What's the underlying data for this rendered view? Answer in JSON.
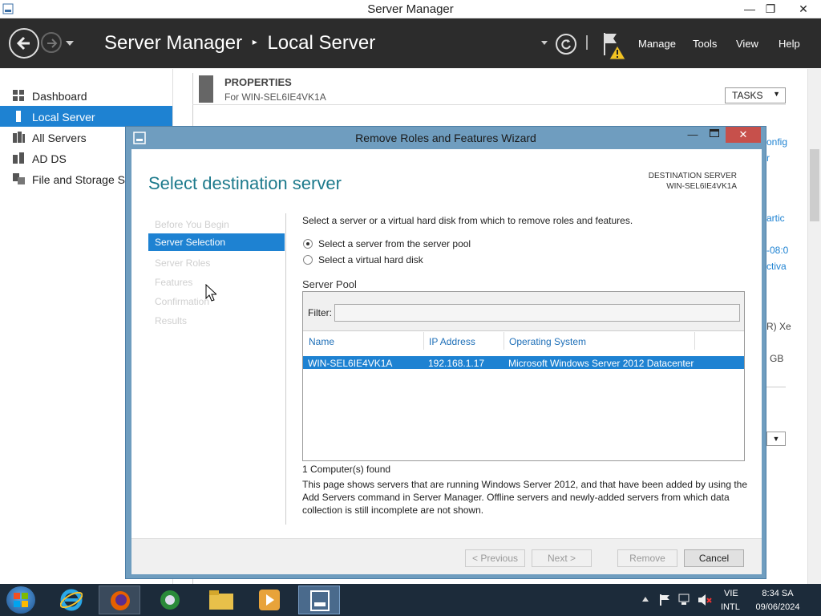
{
  "window": {
    "title": "Server Manager"
  },
  "header": {
    "breadcrumb_root": "Server Manager",
    "breadcrumb_sep": "▸",
    "breadcrumb_leaf": "Local Server",
    "menus": [
      "Manage",
      "Tools",
      "View",
      "Help"
    ]
  },
  "nav": {
    "items": [
      {
        "label": "Dashboard",
        "icon": "dashboard-icon"
      },
      {
        "label": "Local Server",
        "icon": "local-server-icon"
      },
      {
        "label": "All Servers",
        "icon": "all-servers-icon"
      },
      {
        "label": "AD DS",
        "icon": "ad-ds-icon"
      },
      {
        "label": "File and Storage Se",
        "icon": "file-storage-icon"
      }
    ]
  },
  "properties": {
    "heading": "PROPERTIES",
    "sub": "For WIN-SEL6IE4VK1A",
    "tasks": "TASKS",
    "peek": [
      "onfig",
      "r",
      "artic",
      "-08:0",
      "ctiva",
      "R) Xe",
      "GB"
    ]
  },
  "dialog": {
    "title": "Remove Roles and Features Wizard",
    "heading": "Select destination server",
    "dest_label": "DESTINATION SERVER",
    "dest_value": "WIN-SEL6IE4VK1A",
    "steps": [
      "Before You Begin",
      "Server Selection",
      "Server Roles",
      "Features",
      "Confirmation",
      "Results"
    ],
    "intro": "Select a server or a virtual hard disk from which to remove roles and features.",
    "radio1": "Select a server from the server pool",
    "radio2": "Select a virtual hard disk",
    "pool_label": "Server Pool",
    "filter_label": "Filter:",
    "columns": [
      "Name",
      "IP Address",
      "Operating System"
    ],
    "row": {
      "name": "WIN-SEL6IE4VK1A",
      "ip": "192.168.1.17",
      "os": "Microsoft Windows Server 2012 Datacenter"
    },
    "found": "1 Computer(s) found",
    "note": "This page shows servers that are running Windows Server 2012, and that have been added by using the Add Servers command in Server Manager. Offline servers and newly-added servers from which data collection is still incomplete are not shown.",
    "buttons": {
      "previous": "< Previous",
      "next": "Next >",
      "remove": "Remove",
      "cancel": "Cancel"
    }
  },
  "taskbar": {
    "lang": "VIE",
    "layout": "INTL",
    "time": "8:34 SA",
    "date": "09/06/2024"
  },
  "colors": {
    "accent": "#1e82d2",
    "header_bg": "#2c2c2c",
    "dialog_frame": "#6f9dbf",
    "heading_teal": "#1d7a8c"
  }
}
